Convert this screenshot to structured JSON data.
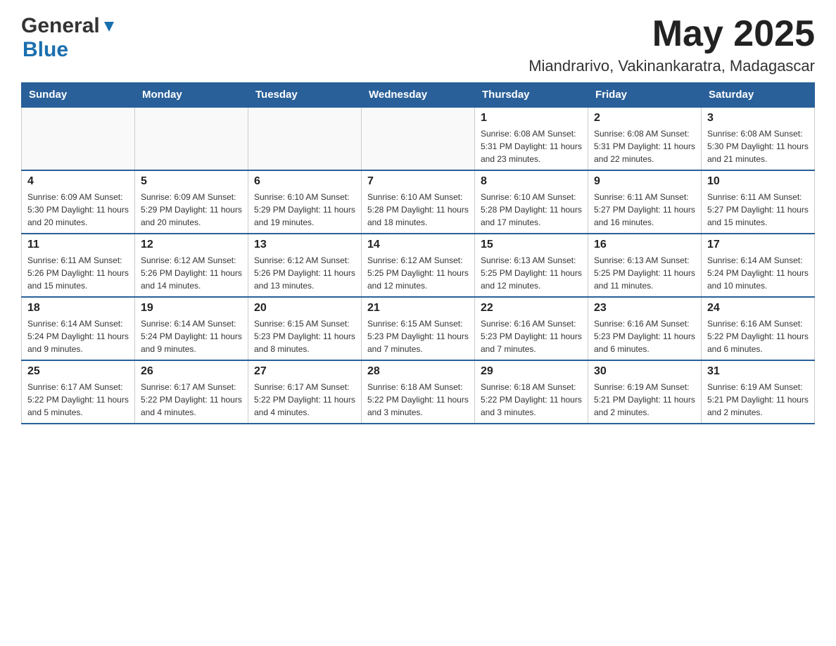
{
  "header": {
    "logo": {
      "general": "General",
      "blue": "Blue"
    },
    "month": "May 2025",
    "location": "Miandrarivo, Vakinankaratra, Madagascar"
  },
  "days_of_week": [
    "Sunday",
    "Monday",
    "Tuesday",
    "Wednesday",
    "Thursday",
    "Friday",
    "Saturday"
  ],
  "weeks": [
    [
      {
        "day": "",
        "info": ""
      },
      {
        "day": "",
        "info": ""
      },
      {
        "day": "",
        "info": ""
      },
      {
        "day": "",
        "info": ""
      },
      {
        "day": "1",
        "info": "Sunrise: 6:08 AM\nSunset: 5:31 PM\nDaylight: 11 hours and 23 minutes."
      },
      {
        "day": "2",
        "info": "Sunrise: 6:08 AM\nSunset: 5:31 PM\nDaylight: 11 hours and 22 minutes."
      },
      {
        "day": "3",
        "info": "Sunrise: 6:08 AM\nSunset: 5:30 PM\nDaylight: 11 hours and 21 minutes."
      }
    ],
    [
      {
        "day": "4",
        "info": "Sunrise: 6:09 AM\nSunset: 5:30 PM\nDaylight: 11 hours and 20 minutes."
      },
      {
        "day": "5",
        "info": "Sunrise: 6:09 AM\nSunset: 5:29 PM\nDaylight: 11 hours and 20 minutes."
      },
      {
        "day": "6",
        "info": "Sunrise: 6:10 AM\nSunset: 5:29 PM\nDaylight: 11 hours and 19 minutes."
      },
      {
        "day": "7",
        "info": "Sunrise: 6:10 AM\nSunset: 5:28 PM\nDaylight: 11 hours and 18 minutes."
      },
      {
        "day": "8",
        "info": "Sunrise: 6:10 AM\nSunset: 5:28 PM\nDaylight: 11 hours and 17 minutes."
      },
      {
        "day": "9",
        "info": "Sunrise: 6:11 AM\nSunset: 5:27 PM\nDaylight: 11 hours and 16 minutes."
      },
      {
        "day": "10",
        "info": "Sunrise: 6:11 AM\nSunset: 5:27 PM\nDaylight: 11 hours and 15 minutes."
      }
    ],
    [
      {
        "day": "11",
        "info": "Sunrise: 6:11 AM\nSunset: 5:26 PM\nDaylight: 11 hours and 15 minutes."
      },
      {
        "day": "12",
        "info": "Sunrise: 6:12 AM\nSunset: 5:26 PM\nDaylight: 11 hours and 14 minutes."
      },
      {
        "day": "13",
        "info": "Sunrise: 6:12 AM\nSunset: 5:26 PM\nDaylight: 11 hours and 13 minutes."
      },
      {
        "day": "14",
        "info": "Sunrise: 6:12 AM\nSunset: 5:25 PM\nDaylight: 11 hours and 12 minutes."
      },
      {
        "day": "15",
        "info": "Sunrise: 6:13 AM\nSunset: 5:25 PM\nDaylight: 11 hours and 12 minutes."
      },
      {
        "day": "16",
        "info": "Sunrise: 6:13 AM\nSunset: 5:25 PM\nDaylight: 11 hours and 11 minutes."
      },
      {
        "day": "17",
        "info": "Sunrise: 6:14 AM\nSunset: 5:24 PM\nDaylight: 11 hours and 10 minutes."
      }
    ],
    [
      {
        "day": "18",
        "info": "Sunrise: 6:14 AM\nSunset: 5:24 PM\nDaylight: 11 hours and 9 minutes."
      },
      {
        "day": "19",
        "info": "Sunrise: 6:14 AM\nSunset: 5:24 PM\nDaylight: 11 hours and 9 minutes."
      },
      {
        "day": "20",
        "info": "Sunrise: 6:15 AM\nSunset: 5:23 PM\nDaylight: 11 hours and 8 minutes."
      },
      {
        "day": "21",
        "info": "Sunrise: 6:15 AM\nSunset: 5:23 PM\nDaylight: 11 hours and 7 minutes."
      },
      {
        "day": "22",
        "info": "Sunrise: 6:16 AM\nSunset: 5:23 PM\nDaylight: 11 hours and 7 minutes."
      },
      {
        "day": "23",
        "info": "Sunrise: 6:16 AM\nSunset: 5:23 PM\nDaylight: 11 hours and 6 minutes."
      },
      {
        "day": "24",
        "info": "Sunrise: 6:16 AM\nSunset: 5:22 PM\nDaylight: 11 hours and 6 minutes."
      }
    ],
    [
      {
        "day": "25",
        "info": "Sunrise: 6:17 AM\nSunset: 5:22 PM\nDaylight: 11 hours and 5 minutes."
      },
      {
        "day": "26",
        "info": "Sunrise: 6:17 AM\nSunset: 5:22 PM\nDaylight: 11 hours and 4 minutes."
      },
      {
        "day": "27",
        "info": "Sunrise: 6:17 AM\nSunset: 5:22 PM\nDaylight: 11 hours and 4 minutes."
      },
      {
        "day": "28",
        "info": "Sunrise: 6:18 AM\nSunset: 5:22 PM\nDaylight: 11 hours and 3 minutes."
      },
      {
        "day": "29",
        "info": "Sunrise: 6:18 AM\nSunset: 5:22 PM\nDaylight: 11 hours and 3 minutes."
      },
      {
        "day": "30",
        "info": "Sunrise: 6:19 AM\nSunset: 5:21 PM\nDaylight: 11 hours and 2 minutes."
      },
      {
        "day": "31",
        "info": "Sunrise: 6:19 AM\nSunset: 5:21 PM\nDaylight: 11 hours and 2 minutes."
      }
    ]
  ]
}
